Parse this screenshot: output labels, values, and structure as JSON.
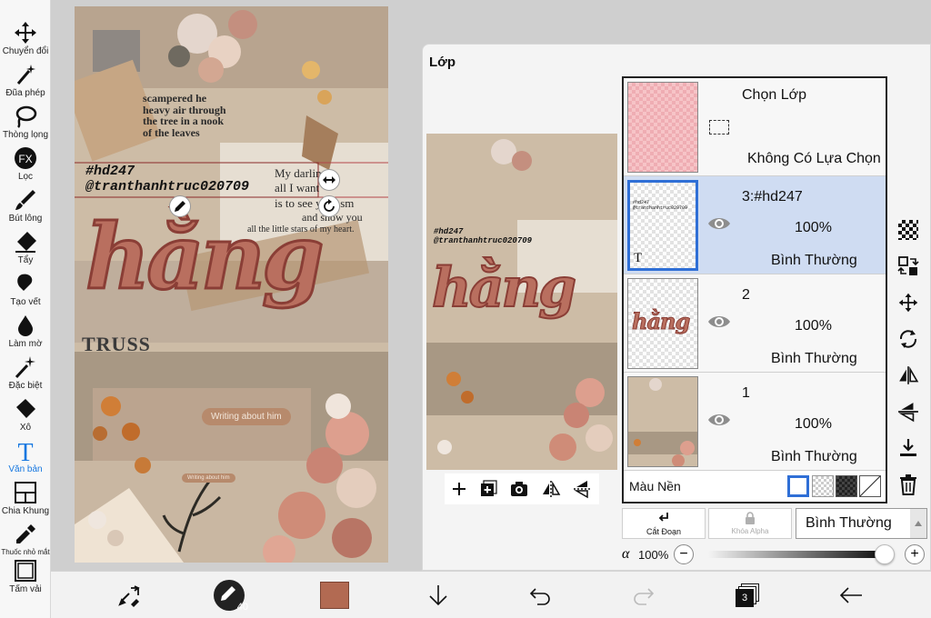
{
  "toolbar": {
    "tools": [
      {
        "label": "Chuyển đổi",
        "icon": "move-arrows-icon"
      },
      {
        "label": "Đũa phép",
        "icon": "magic-wand-icon"
      },
      {
        "label": "Thòng lọng",
        "icon": "lasso-icon"
      },
      {
        "label": "Lọc",
        "icon": "fx-filter-icon"
      },
      {
        "label": "Bút lông",
        "icon": "brush-icon"
      },
      {
        "label": "Tẩy",
        "icon": "eraser-icon"
      },
      {
        "label": "Tạo vết",
        "icon": "smudge-icon"
      },
      {
        "label": "Làm mờ",
        "icon": "blur-drop-icon"
      },
      {
        "label": "Đặc biệt",
        "icon": "sparkle-icon"
      },
      {
        "label": "Xô",
        "icon": "bucket-icon"
      },
      {
        "label": "Văn bản",
        "icon": "text-t-icon"
      },
      {
        "label": "Chia Khung",
        "icon": "frame-divider-icon"
      },
      {
        "label": "Thuốc nhỏ mắt",
        "icon": "eyedropper-icon"
      },
      {
        "label": "Tấm vải",
        "icon": "canvas-icon"
      }
    ],
    "active_tool": "Văn bản"
  },
  "artwork": {
    "text_line1": "#hd247",
    "text_line2": "@tranthanhtruc020709",
    "title_word": "hằng",
    "poem": [
      "My darling,",
      "all I want",
      "is to see your sm",
      "and show you",
      "all the little stars of my heart."
    ],
    "tag1": "Writing about him",
    "tag2": "Writing about him",
    "truss": "TRUSS",
    "news_text": "scampered he heavy air through the tree in a nook of the leaves"
  },
  "bottom_bar": {
    "brush_size": "40",
    "color_swatch": "#b26a52",
    "layer_count": "3"
  },
  "layer_panel": {
    "title": "Lớp",
    "selection_row": {
      "title": "Chọn Lớp",
      "status": "Không Có Lựa Chọn"
    },
    "layers": [
      {
        "name": "3:#hd247",
        "opacity": "100%",
        "blend": "Bình Thường",
        "selected": true
      },
      {
        "name": "2",
        "opacity": "100%",
        "blend": "Bình Thường",
        "selected": false
      },
      {
        "name": "1",
        "opacity": "100%",
        "blend": "Bình Thường",
        "selected": false
      }
    ],
    "background_label": "Màu Nền",
    "clip_label": "Cắt Đoạn",
    "alpha_lock_label": "Khóa Alpha",
    "blend_mode": "Bình Thường",
    "alpha_symbol": "α",
    "alpha_value": "100%",
    "thumb_text": "hằng"
  },
  "colors": {
    "accent": "#1677e0",
    "selected_row": "#cfdcf2",
    "hang_fill": "#b96f5f",
    "hang_outline": "#8a3e36"
  }
}
